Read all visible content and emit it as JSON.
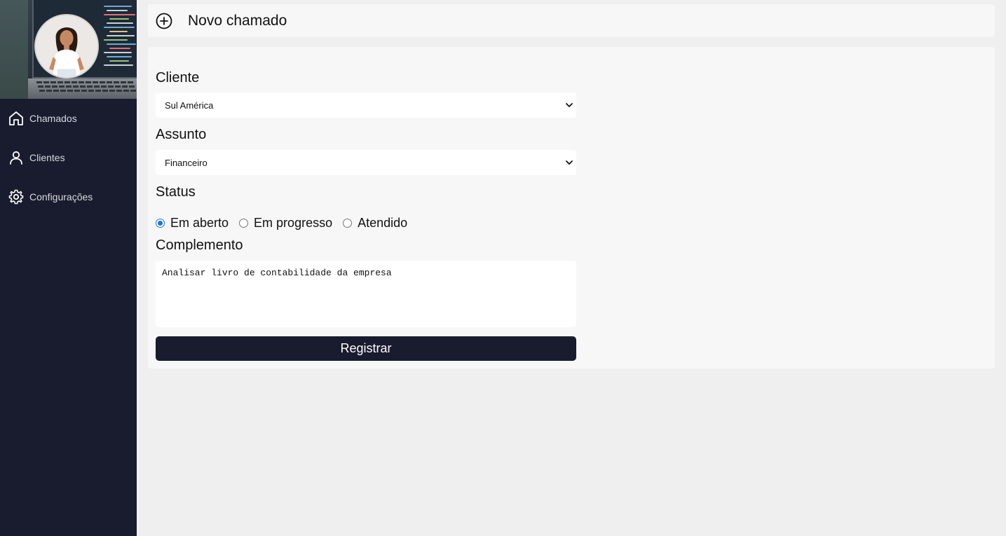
{
  "sidebar": {
    "items": [
      {
        "label": "Chamados",
        "icon": "home-icon"
      },
      {
        "label": "Clientes",
        "icon": "user-icon"
      },
      {
        "label": "Configurações",
        "icon": "gear-icon"
      }
    ]
  },
  "header": {
    "title": "Novo chamado",
    "icon": "plus-circle-icon"
  },
  "form": {
    "cliente_label": "Cliente",
    "cliente_value": "Sul América",
    "assunto_label": "Assunto",
    "assunto_value": "Financeiro",
    "status_label": "Status",
    "status_options": [
      {
        "label": "Em aberto",
        "checked": true
      },
      {
        "label": "Em progresso",
        "checked": false
      },
      {
        "label": "Atendido",
        "checked": false
      }
    ],
    "complemento_label": "Complemento",
    "complemento_value": "Analisar livro de contabilidade da empresa",
    "submit_label": "Registrar"
  },
  "colors": {
    "sidebar_bg": "#181c2e",
    "page_bg": "#efefef",
    "panel_bg": "#f7f7f7",
    "button_bg": "#181c2e",
    "radio_accent": "#1a73e8"
  }
}
